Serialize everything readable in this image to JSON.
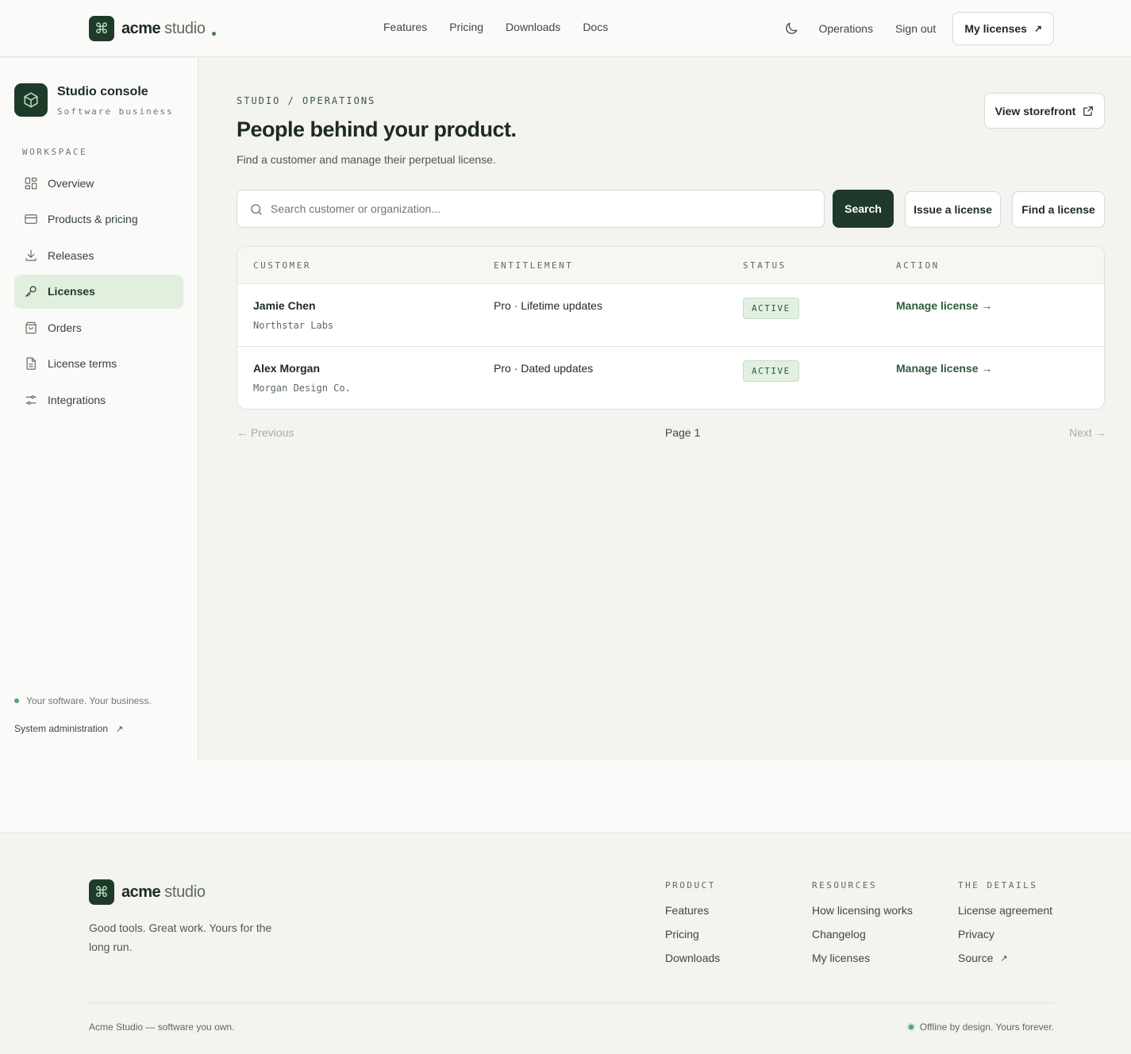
{
  "header": {
    "brand_symbol": "⌘",
    "brand_name": "acme",
    "brand_sub": "studio",
    "nav": [
      "Features",
      "Pricing",
      "Downloads",
      "Docs"
    ],
    "theme_icon": "moon-icon",
    "operations": "Operations",
    "sign_out": "Sign out",
    "my_licenses": "My licenses",
    "external_arrow": "↗"
  },
  "sidebar": {
    "title": "Studio console",
    "subtitle": "Software business",
    "section": "WORKSPACE",
    "items": [
      {
        "label": "Overview",
        "icon": "grid-icon"
      },
      {
        "label": "Products & pricing",
        "icon": "card-icon"
      },
      {
        "label": "Releases",
        "icon": "download-icon"
      },
      {
        "label": "Licenses",
        "icon": "key-icon",
        "active": true
      },
      {
        "label": "Orders",
        "icon": "bag-icon"
      },
      {
        "label": "License terms",
        "icon": "document-icon"
      },
      {
        "label": "Integrations",
        "icon": "sliders-icon"
      }
    ],
    "tagline": "Your software. Your business.",
    "system_admin": "System administration"
  },
  "main": {
    "breadcrumb": "STUDIO / OPERATIONS",
    "title": "People behind your product.",
    "subtitle": "Find a customer and manage their perpetual license.",
    "view_storefront": "View storefront",
    "search_placeholder": "Search customer or organization...",
    "search_button": "Search",
    "issue_button": "Issue a license",
    "find_button": "Find a license",
    "columns": [
      "CUSTOMER",
      "ENTITLEMENT",
      "STATUS",
      "ACTION"
    ],
    "rows": [
      {
        "name": "Jamie Chen",
        "org": "Northstar Labs",
        "entitlement": "Pro · Lifetime updates",
        "status": "ACTIVE",
        "action": "Manage license →"
      },
      {
        "name": "Alex Morgan",
        "org": "Morgan Design Co.",
        "entitlement": "Pro · Dated updates",
        "status": "ACTIVE",
        "action": "Manage license →"
      }
    ],
    "prev": "← Previous",
    "page": "Page 1",
    "next": "Next →"
  },
  "footer": {
    "tagline": "Good tools. Great work. Yours for the long run.",
    "columns": [
      {
        "head": "PRODUCT",
        "links": [
          "Features",
          "Pricing",
          "Downloads"
        ]
      },
      {
        "head": "RESOURCES",
        "links": [
          "How licensing works",
          "Changelog",
          "My licenses"
        ]
      },
      {
        "head": "THE DETAILS",
        "links": [
          "License agreement",
          "Privacy",
          "Source"
        ]
      }
    ],
    "copyright": "Acme Studio — software you own.",
    "offline": "Offline by design. Yours forever."
  },
  "colors": {
    "accent_dark": "#1f3a2b",
    "active_bg": "#e2efdf",
    "status_green": "#2d5a3c",
    "page_bg": "#f3f3ef"
  }
}
